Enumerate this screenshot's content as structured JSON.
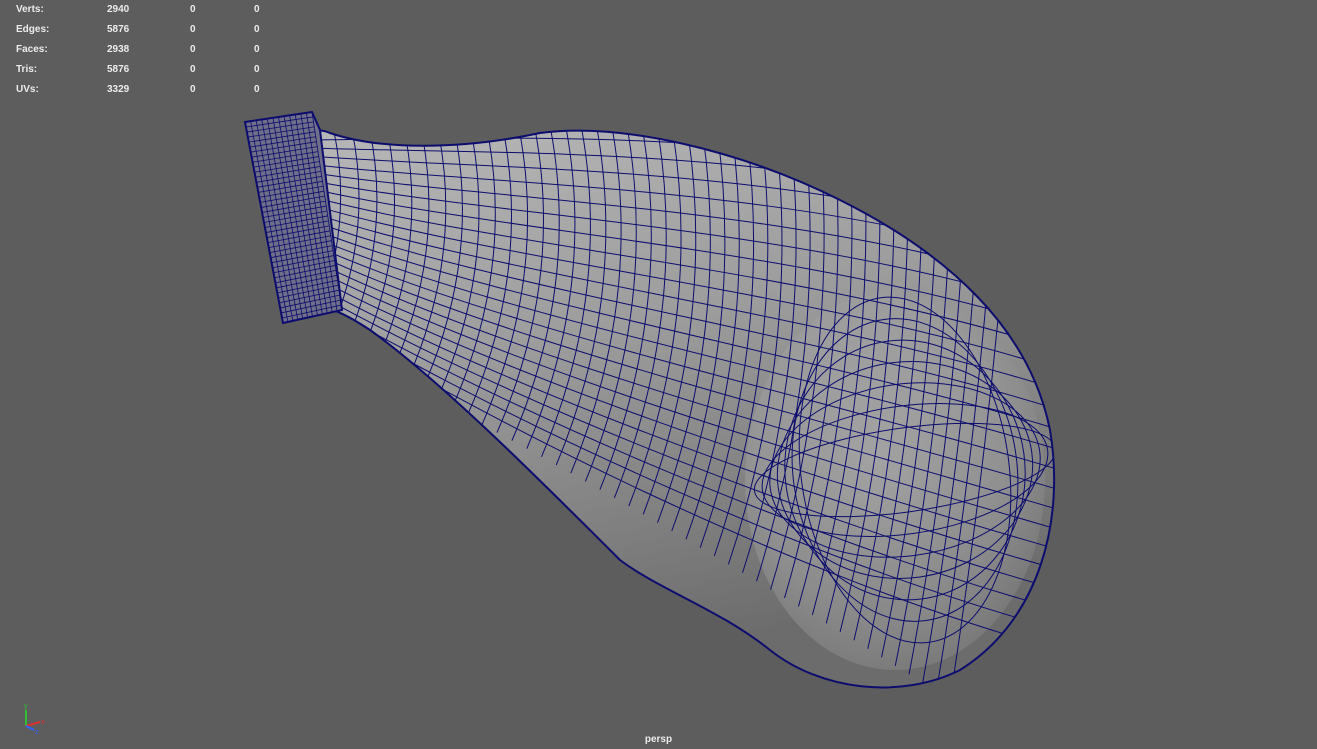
{
  "hud": {
    "rows": [
      {
        "label": "Verts:",
        "values": [
          "2940",
          "0",
          "0"
        ]
      },
      {
        "label": "Edges:",
        "values": [
          "5876",
          "0",
          "0"
        ]
      },
      {
        "label": "Faces:",
        "values": [
          "2938",
          "0",
          "0"
        ]
      },
      {
        "label": "Tris:",
        "values": [
          "5876",
          "0",
          "0"
        ]
      },
      {
        "label": "UVs:",
        "values": [
          "3329",
          "0",
          "0"
        ]
      }
    ]
  },
  "viewport": {
    "camera_name": "persp",
    "background_color": "#5d5d5d",
    "wireframe_color": "#0d0d6e",
    "mesh_color": "#9a9a9a"
  },
  "gizmo": {
    "x_label": "x",
    "y_label": "y",
    "z_label": "z",
    "x_color": "#e03030",
    "y_color": "#30c030",
    "z_color": "#3060ff"
  }
}
